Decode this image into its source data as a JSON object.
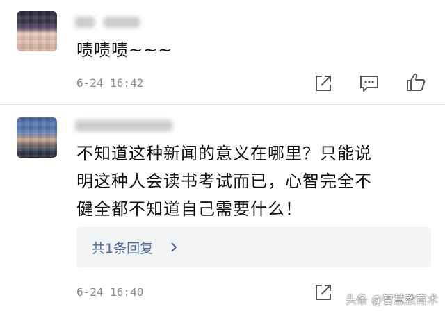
{
  "comments": [
    {
      "text": "啧啧啧~~~",
      "time": "6-24 16:42"
    },
    {
      "text_lines": [
        "不知道这种新闻的意义在哪里？只能说",
        "明这种人会读书考试而已，心智完全不",
        "健全都不知道自己需要什么！"
      ],
      "time": "6-24 16:40",
      "replies_label": "共1条回复"
    }
  ],
  "watermark": "头条 @智慧教育术",
  "colors": {
    "text": "#111111",
    "meta": "#8a8a8a",
    "link": "#4a6a9a",
    "reply_box": "#f2f3f5"
  },
  "icons": {
    "share": "share-icon",
    "reply": "comment-icon",
    "like": "thumbs-up-icon",
    "chevron": "chevron-right-icon"
  }
}
